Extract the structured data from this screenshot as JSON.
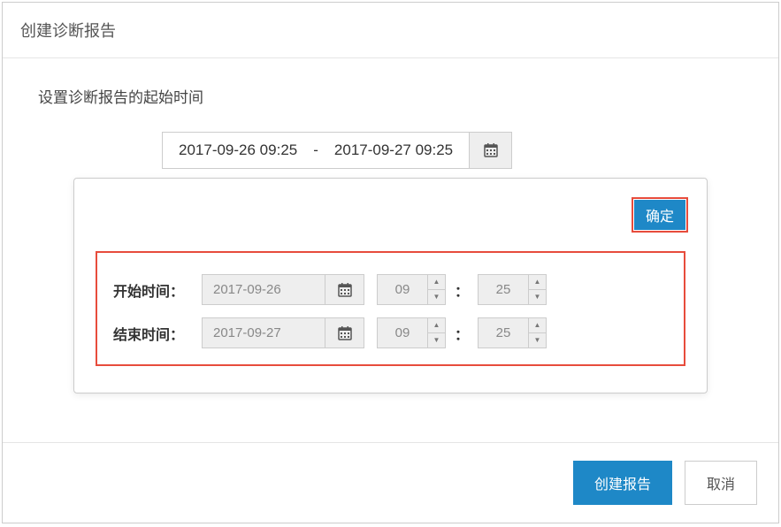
{
  "modal": {
    "title": "创建诊断报告",
    "section_label": "设置诊断报告的起始时间",
    "range_display": {
      "start": "2017-09-26 09:25",
      "separator": "-",
      "end": "2017-09-27 09:25"
    },
    "picker": {
      "ok_label": "确定",
      "rows": [
        {
          "label": "开始时间：",
          "date": "2017-09-26",
          "hour": "09",
          "minute": "25"
        },
        {
          "label": "结束时间：",
          "date": "2017-09-27",
          "hour": "09",
          "minute": "25"
        }
      ],
      "colon": "："
    },
    "footer": {
      "create_label": "创建报告",
      "cancel_label": "取消"
    }
  }
}
